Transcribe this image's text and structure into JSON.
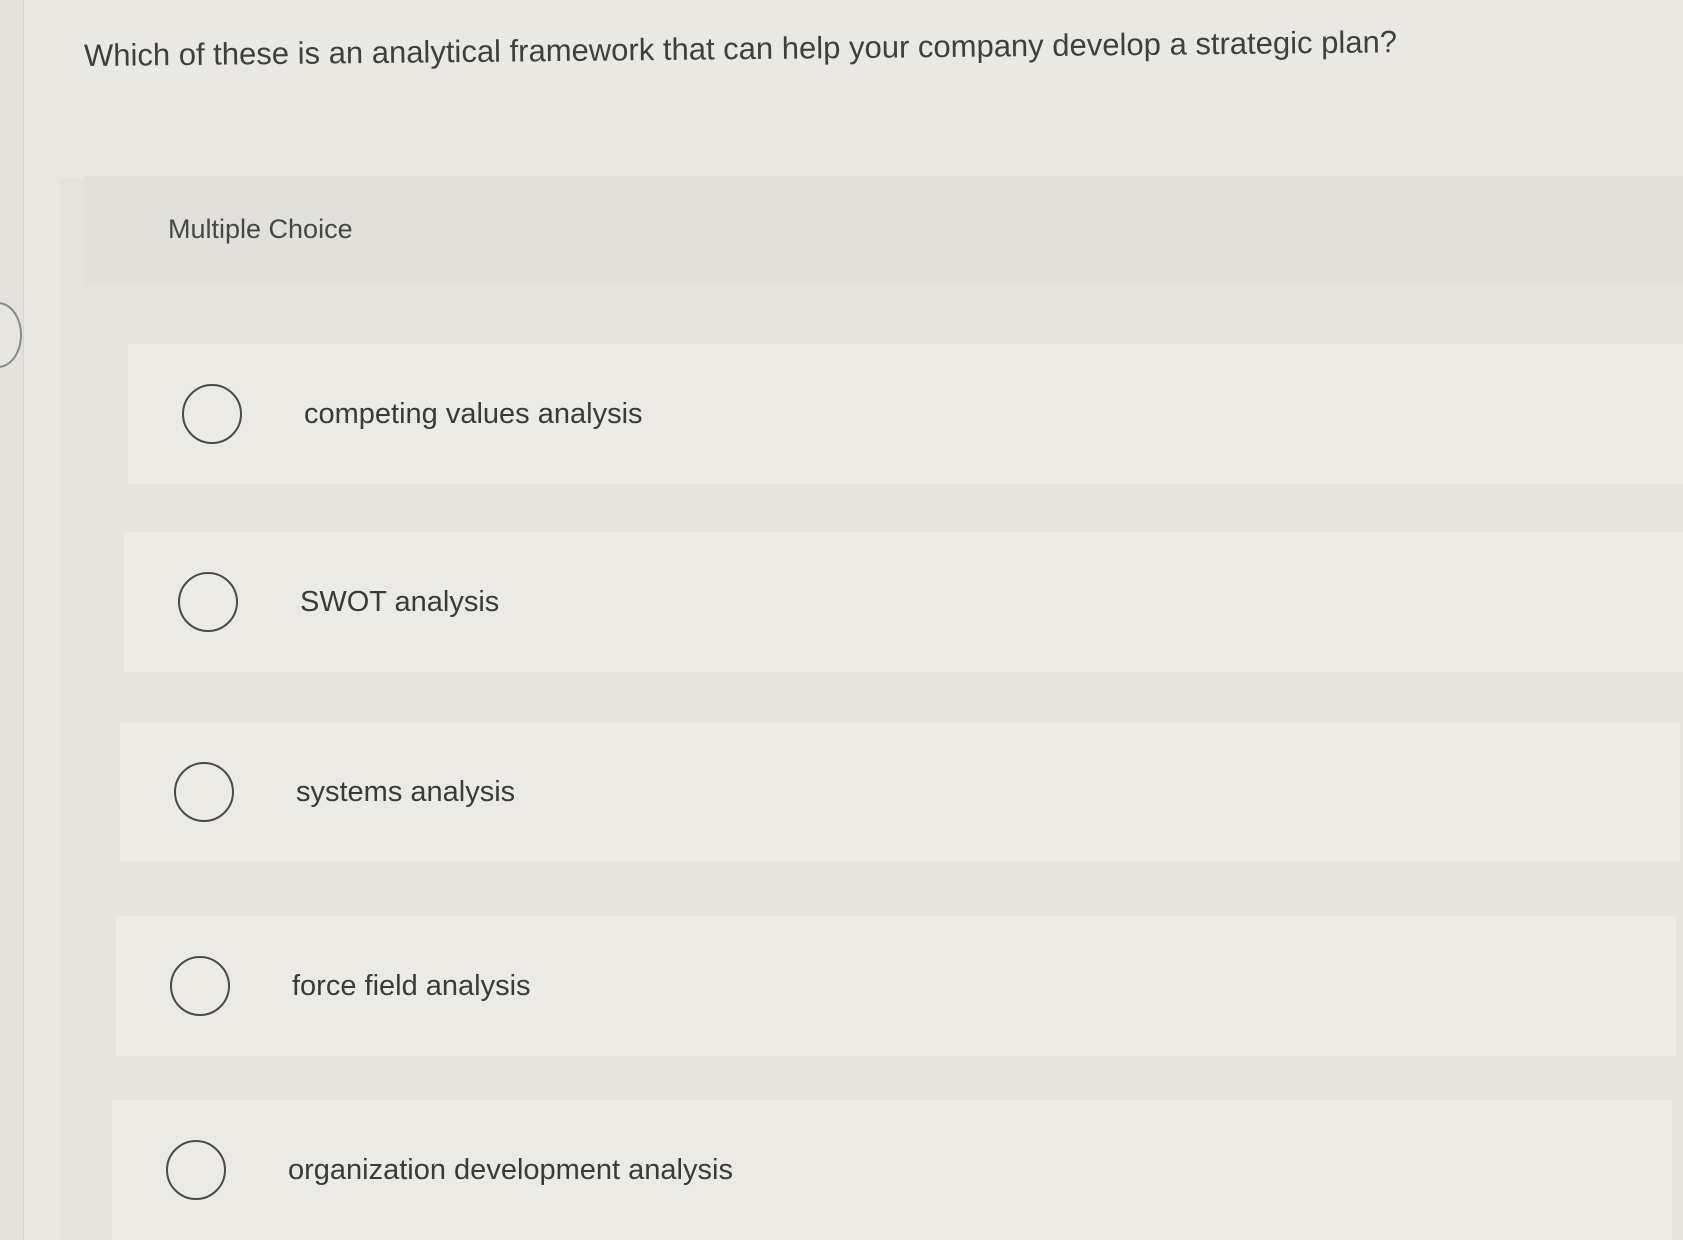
{
  "question": {
    "text": "Which of these is an analytical framework that can help your company develop a strategic plan?"
  },
  "answer_panel": {
    "type_label": "Multiple Choice",
    "options": [
      {
        "label": "competing values analysis",
        "selected": false
      },
      {
        "label": "SWOT analysis",
        "selected": false
      },
      {
        "label": "systems analysis",
        "selected": false
      },
      {
        "label": "force field analysis",
        "selected": false
      },
      {
        "label": "organization development analysis",
        "selected": false
      }
    ]
  },
  "colors": {
    "background": "#e9e8e3",
    "panel": "#e4e3de",
    "option_row": "#ebeae5",
    "text": "#3d3d3d"
  }
}
